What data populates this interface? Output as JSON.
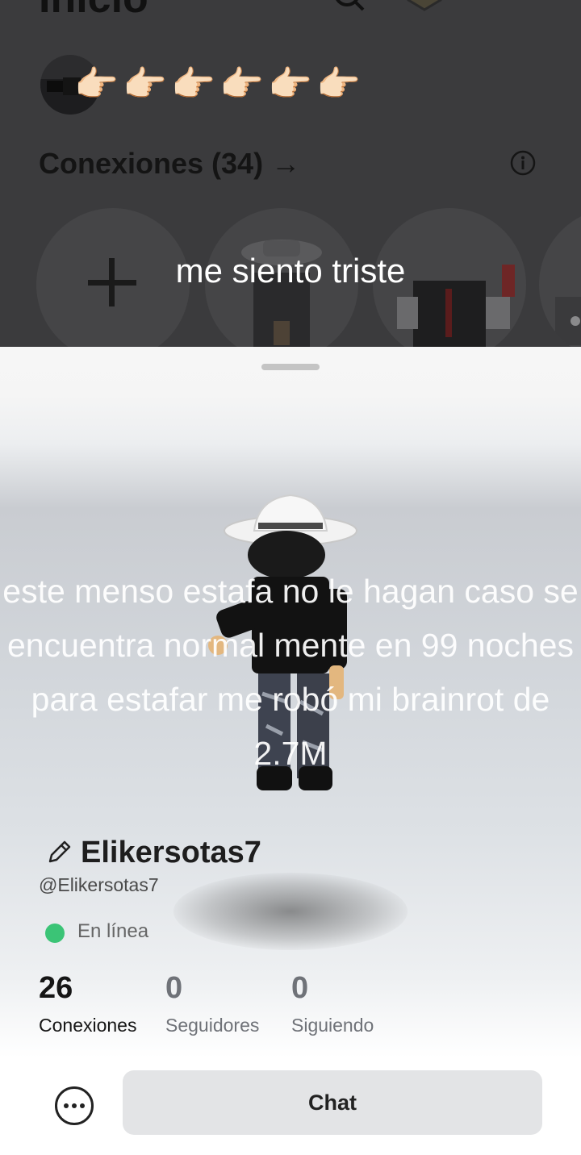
{
  "home": {
    "title": "Inicio",
    "icons": [
      "search-icon",
      "premium-badge-icon",
      "notifications-icon"
    ],
    "status_emojis": [
      "👉🏻",
      "👉🏻",
      "👉🏻",
      "👉🏻",
      "👉🏻",
      "👉🏻"
    ],
    "connections_title": "Conexiones (34) →",
    "add_icon": "plus-icon",
    "caption": "me siento triste"
  },
  "profile": {
    "overlay_text": "este menso estafa no le hagan caso se encuentra normal mente en 99 noches para estafar me robó mi brainrot de 2.7M",
    "display_name": "Elikersotas7",
    "username": "@Elikersotas7",
    "status": "En línea",
    "status_color": "#3bc476",
    "stats": [
      {
        "value": "26",
        "label": "Conexiones"
      },
      {
        "value": "0",
        "label": "Seguidores"
      },
      {
        "value": "0",
        "label": "Siguiendo"
      }
    ],
    "chat_label": "Chat"
  }
}
